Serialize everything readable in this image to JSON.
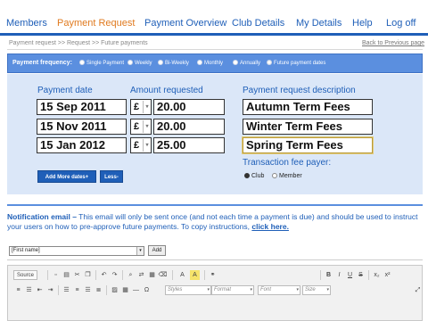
{
  "nav": {
    "items": [
      "Members",
      "Payment Request",
      "Payment Overview",
      "Club Details",
      "My Details",
      "Help",
      "Log off"
    ],
    "active_index": 1
  },
  "breadcrumb": "Payment request >> Request >> Future payments",
  "back_link": "Back to Previous page",
  "frequency": {
    "label": "Payment frequency:",
    "options": [
      "Single Payment",
      "Weekly",
      "Bi-Weekly",
      "Monthly",
      "Annually",
      "Future payment dates"
    ],
    "selected": "Future payment dates"
  },
  "table": {
    "headers": {
      "date": "Payment date",
      "amount": "Amount requested",
      "description": "Payment request description"
    },
    "currency_symbol": "£",
    "rows": [
      {
        "date": "15 Sep 2011",
        "amount": "20.00",
        "description": "Autumn Term Fees"
      },
      {
        "date": "15 Nov 2011",
        "amount": "20.00",
        "description": "Winter Term Fees"
      },
      {
        "date": "15 Jan 2012",
        "amount": "25.00",
        "description": "Spring Term Fees"
      }
    ]
  },
  "buttons": {
    "add_more": "Add More dates+",
    "less": "Less-"
  },
  "fee": {
    "label": "Transaction fee payer:",
    "options": [
      "Club",
      "Member"
    ],
    "selected": "Club"
  },
  "notification": {
    "heading": "Notification email –",
    "text": " This email will only be sent once (and not each time a payment is due) and should be used to instruct your users on how to pre-approve future payments. To copy instructions, ",
    "link": "click here."
  },
  "field_select": {
    "value": "[First name]",
    "add_label": "Add"
  },
  "editor": {
    "source_label": "Source",
    "styles": "Styles",
    "format": "Format",
    "font": "Font",
    "size": "Size",
    "bold": "B",
    "italic": "I",
    "underline": "U",
    "strike": "S",
    "subscript": "x₂",
    "superscript": "x²"
  },
  "colors": {
    "brand_blue": "#1f5fb8",
    "active_orange": "#e07a1f",
    "panel_bg": "#dbe7f8",
    "bar_blue": "#5b8fdf"
  }
}
